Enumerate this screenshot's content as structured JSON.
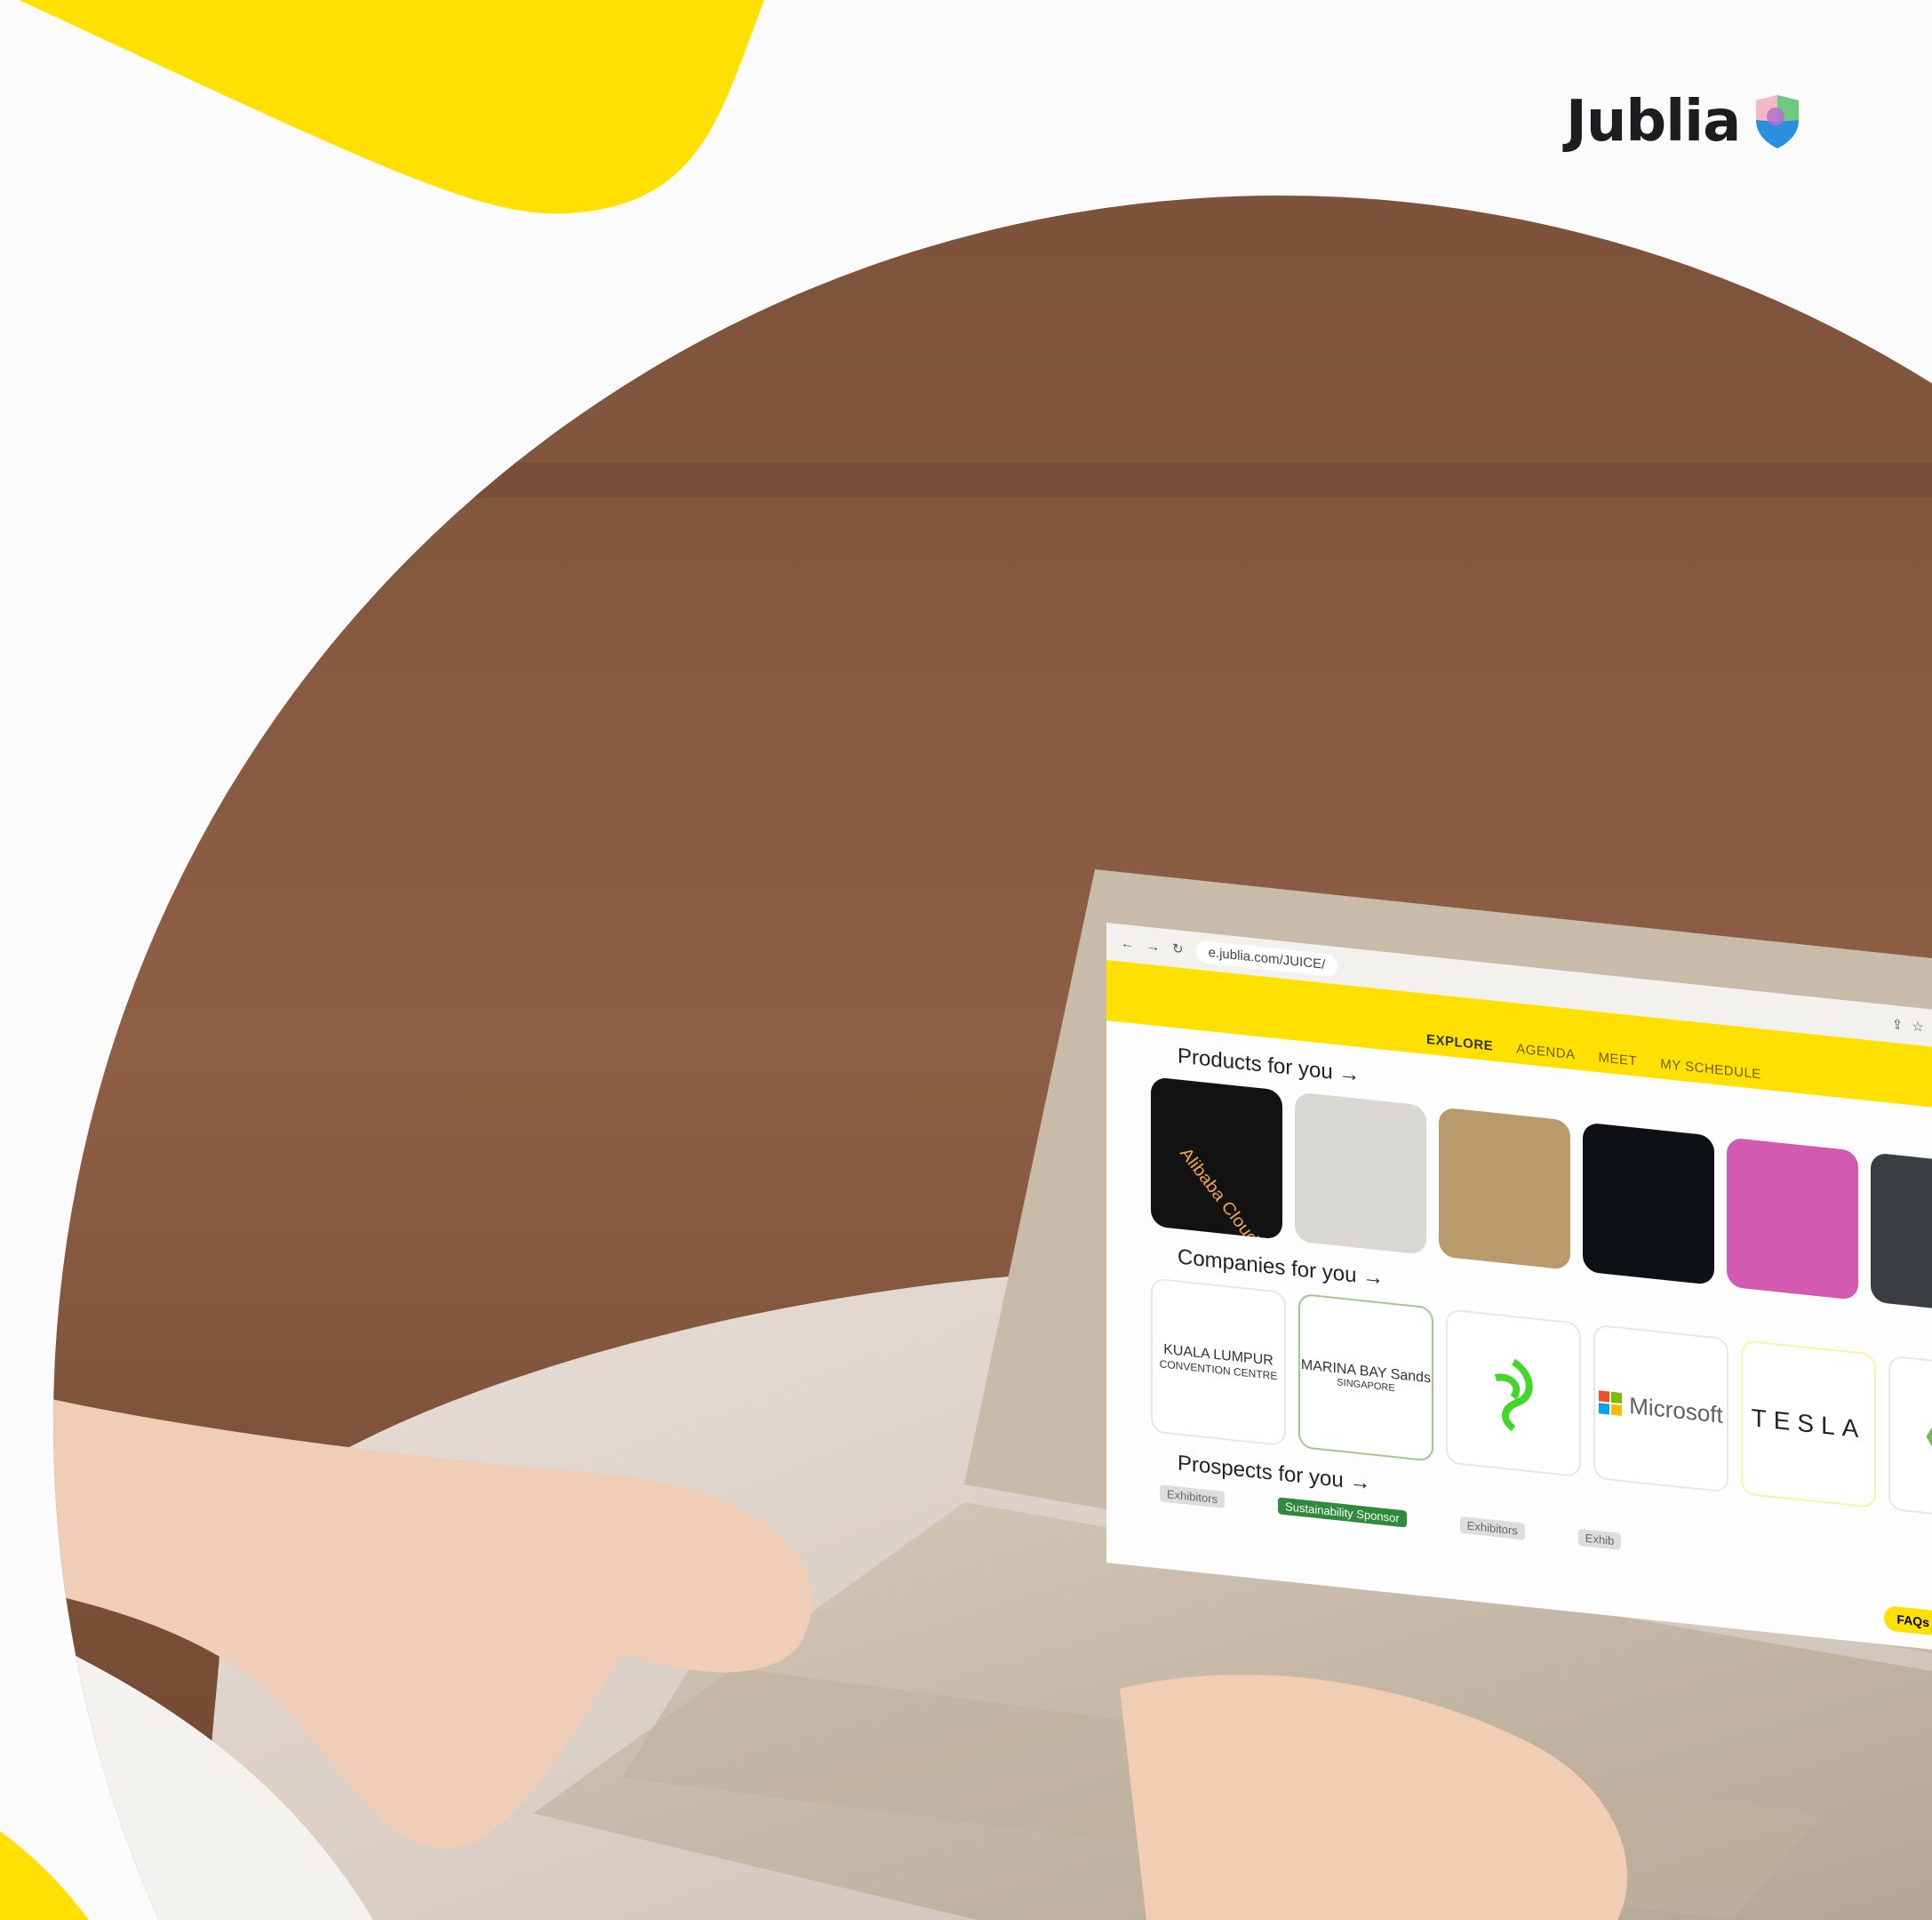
{
  "brand": {
    "name": "Jublia"
  },
  "browser": {
    "url": "e.jublia.com/JUICE/"
  },
  "nav": {
    "explore": "EXPLORE",
    "agenda": "AGENDA",
    "meet": "MEET",
    "schedule": "MY SCHEDULE"
  },
  "sections": {
    "products": "Products for you →",
    "companies": "Companies for you →",
    "prospects": "Prospects for you →"
  },
  "products": {
    "tile1_caption": "Alibaba Cloud"
  },
  "companies": {
    "klcc_line1": "KUALA LUMPUR",
    "klcc_line2": "CONVENTION CENTRE",
    "mbs_line1": "MARINA BAY",
    "mbs_line2": "Sands",
    "mbs_line3": "SINGAPORE",
    "microsoft": "Microsoft",
    "tesla": "TESLA"
  },
  "prospect_tags": {
    "t1": "Exhibitors",
    "t2": "Sustainability Sponsor",
    "t3": "Exhibitors",
    "t4": "Exhib"
  },
  "faq": "FAQs",
  "colors": {
    "accent_yellow": "#ffe000",
    "photo_brown": "#8b6048",
    "laptop_silver": "#cbbfae"
  }
}
